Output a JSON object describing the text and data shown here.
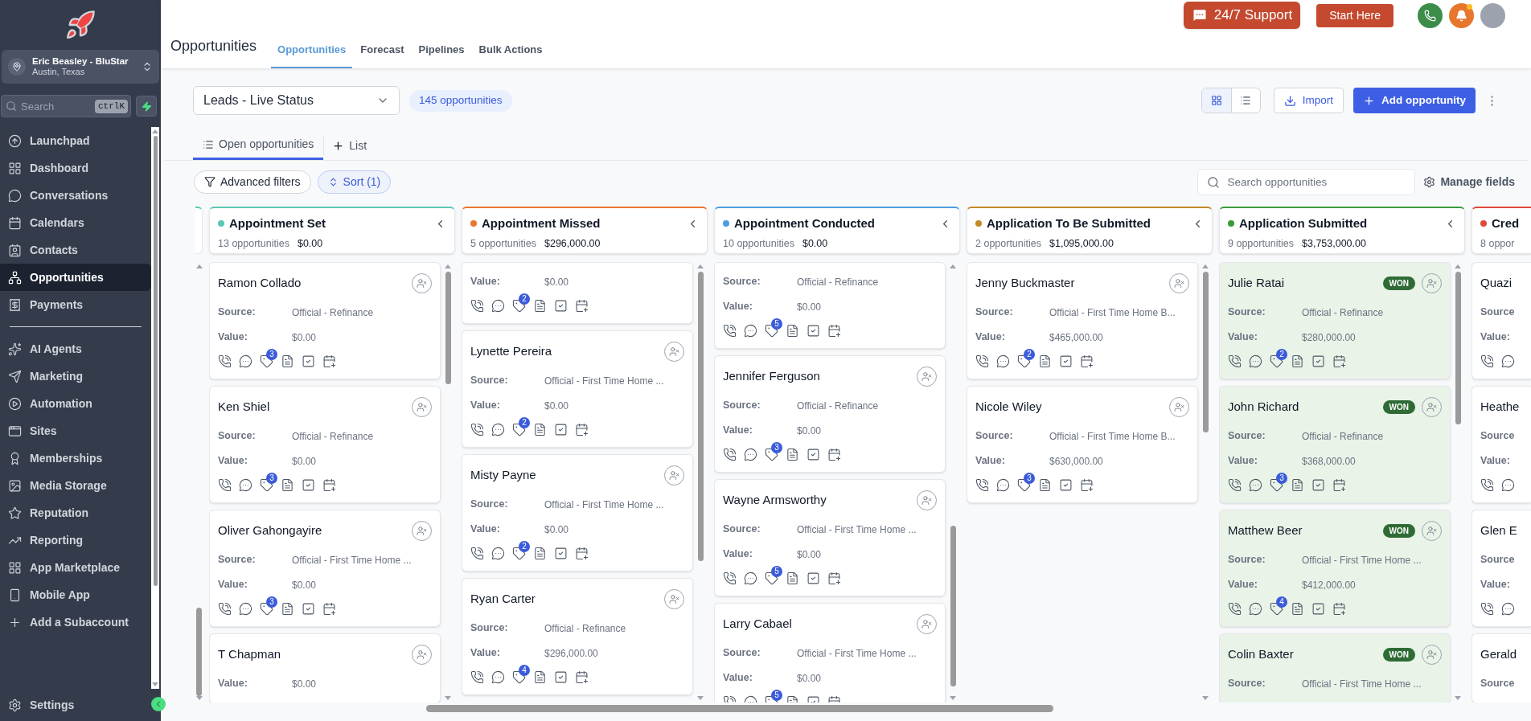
{
  "top_bar": {
    "support_label": "24/7 Support",
    "start_label": "Start Here",
    "has_unread": true
  },
  "sidebar": {
    "account": {
      "name": "Eric Beasley - BluStar",
      "location": "Austin, Texas"
    },
    "search": {
      "placeholder": "Search",
      "shortcut": "ctrlK"
    },
    "items": [
      {
        "label": "Launchpad",
        "selected": false
      },
      {
        "label": "Dashboard",
        "selected": false
      },
      {
        "label": "Conversations",
        "selected": false
      },
      {
        "label": "Calendars",
        "selected": false
      },
      {
        "label": "Contacts",
        "selected": false
      },
      {
        "label": "Opportunities",
        "selected": true
      },
      {
        "label": "Payments",
        "selected": false
      }
    ],
    "items_secondary": [
      {
        "label": "AI Agents",
        "selected": false
      },
      {
        "label": "Marketing",
        "selected": false
      },
      {
        "label": "Automation",
        "selected": false
      },
      {
        "label": "Sites",
        "selected": false
      },
      {
        "label": "Memberships",
        "selected": false
      },
      {
        "label": "Media Storage",
        "selected": false
      },
      {
        "label": "Reputation",
        "selected": false
      },
      {
        "label": "Reporting",
        "selected": false
      },
      {
        "label": "App Marketplace",
        "selected": false
      },
      {
        "label": "Mobile App",
        "selected": false
      },
      {
        "label": "Add a Subaccount",
        "selected": false
      }
    ],
    "settings": "Settings"
  },
  "page": {
    "title": "Opportunities",
    "tabs": [
      {
        "label": "Opportunities",
        "selected": true
      },
      {
        "label": "Forecast",
        "selected": false
      },
      {
        "label": "Pipelines",
        "selected": false
      },
      {
        "label": "Bulk Actions",
        "selected": false
      }
    ]
  },
  "toolbar": {
    "pipeline": "Leads - Live Status",
    "count": "145 opportunities",
    "views": [
      {
        "kind": "grid",
        "selected": true
      },
      {
        "kind": "list",
        "selected": false
      }
    ],
    "import_label": "Import",
    "add_label": "Add opportunity"
  },
  "view_tabs": [
    {
      "label": "Open opportunities",
      "selected": true
    }
  ],
  "add_list_label": "List",
  "filters": {
    "advanced_label": "Advanced filters",
    "sort_label": "Sort (1)",
    "search_placeholder": "Search opportunities",
    "manage_label": "Manage fields"
  },
  "columns": [
    {
      "title": "Appointment Set",
      "color": "#5cc8b4",
      "count": "13 opportunities",
      "total": "$0.00",
      "cards": [
        {
          "kind": "full",
          "name": "Ramon Collado",
          "fields": [
            {
              "label": "Source:",
              "value": "Official - Refinance"
            },
            {
              "label": "Value:",
              "value": "$0.00"
            }
          ],
          "badge": "3"
        },
        {
          "kind": "full",
          "name": "Ken Shiel",
          "fields": [
            {
              "label": "Source:",
              "value": "Official - Refinance"
            },
            {
              "label": "Value:",
              "value": "$0.00"
            }
          ],
          "badge": "3"
        },
        {
          "kind": "full",
          "name": "Oliver Gahongayire",
          "fields": [
            {
              "label": "Source:",
              "value": "Official - First Time Home ..."
            },
            {
              "label": "Value:",
              "value": "$0.00"
            }
          ],
          "badge": "3"
        },
        {
          "kind": "bare",
          "name": "T Chapman",
          "fields": [
            {
              "label": "Value:",
              "value": "$0.00"
            }
          ]
        }
      ]
    },
    {
      "title": "Appointment Missed",
      "color": "#e8772e",
      "count": "5 opportunities",
      "total": "$296,000.00",
      "cards": [
        {
          "kind": "full",
          "fields": [
            {
              "label": "Value:",
              "value": "$0.00"
            }
          ],
          "badge": "2"
        },
        {
          "kind": "full",
          "name": "Lynette Pereira",
          "fields": [
            {
              "label": "Source:",
              "value": "Official - First Time Home ..."
            },
            {
              "label": "Value:",
              "value": "$0.00"
            }
          ],
          "badge": "2"
        },
        {
          "kind": "full",
          "name": "Misty Payne",
          "fields": [
            {
              "label": "Source:",
              "value": "Official - First Time Home ..."
            },
            {
              "label": "Value:",
              "value": "$0.00"
            }
          ],
          "badge": "2"
        },
        {
          "kind": "full",
          "name": "Ryan Carter",
          "fields": [
            {
              "label": "Source:",
              "value": "Official - Refinance"
            },
            {
              "label": "Value:",
              "value": "$296,000.00"
            }
          ],
          "badge": "4"
        }
      ]
    },
    {
      "title": "Appointment Conducted",
      "color": "#4b9de0",
      "count": "10 opportunities",
      "total": "$0.00",
      "cards": [
        {
          "kind": "full",
          "fields": [
            {
              "label": "Source:",
              "value": "Official - Refinance"
            },
            {
              "label": "Value:",
              "value": "$0.00"
            }
          ],
          "badge": "5"
        },
        {
          "kind": "full",
          "name": "Jennifer Ferguson",
          "fields": [
            {
              "label": "Source:",
              "value": "Official - Refinance"
            },
            {
              "label": "Value:",
              "value": "$0.00"
            }
          ],
          "badge": "3"
        },
        {
          "kind": "full",
          "name": "Wayne Armsworthy",
          "fields": [
            {
              "label": "Source:",
              "value": "Official - First Time Home ..."
            },
            {
              "label": "Value:",
              "value": "$0.00"
            }
          ],
          "badge": "5"
        },
        {
          "kind": "full",
          "name": "Larry Cabael",
          "fields": [
            {
              "label": "Source:",
              "value": "Official - First Time Home ..."
            },
            {
              "label": "Value:",
              "value": "$0.00"
            }
          ],
          "badge": "5"
        }
      ]
    },
    {
      "title": "Application To Be Submitted",
      "color": "#c48a2a",
      "count": "2 opportunities",
      "total": "$1,095,000.00",
      "cards": [
        {
          "kind": "full",
          "name": "Jenny Buckmaster",
          "fields": [
            {
              "label": "Source:",
              "value": "Official - First Time Home B..."
            },
            {
              "label": "Value:",
              "value": "$465,000.00"
            }
          ],
          "badge": "2"
        },
        {
          "kind": "full",
          "name": "Nicole Wiley",
          "fields": [
            {
              "label": "Source:",
              "value": "Official - First Time Home B..."
            },
            {
              "label": "Value:",
              "value": "$630,000.00"
            }
          ],
          "badge": "3"
        }
      ]
    },
    {
      "title": "Application Submitted",
      "color": "#3a9a3a",
      "count": "9 opportunities",
      "total": "$3,753,000.00",
      "cards": [
        {
          "kind": "full",
          "name": "Julie Ratai",
          "won": true,
          "status": "WON",
          "fields": [
            {
              "label": "Source:",
              "value": "Official - Refinance"
            },
            {
              "label": "Value:",
              "value": "$280,000.00"
            }
          ],
          "badge": "2"
        },
        {
          "kind": "full",
          "name": "John Richard",
          "won": true,
          "status": "WON",
          "fields": [
            {
              "label": "Source:",
              "value": "Official - Refinance"
            },
            {
              "label": "Value:",
              "value": "$368,000.00"
            }
          ],
          "badge": "3"
        },
        {
          "kind": "full",
          "name": "Matthew Beer",
          "won": true,
          "status": "WON",
          "fields": [
            {
              "label": "Source:",
              "value": "Official - First Time Home ..."
            },
            {
              "label": "Value:",
              "value": "$412,000.00"
            }
          ],
          "badge": "4"
        },
        {
          "kind": "bare",
          "name": "Colin Baxter",
          "won": true,
          "status": "WON",
          "fields": [
            {
              "label": "Source:",
              "value": "Official - First Time Home ..."
            }
          ]
        }
      ]
    },
    {
      "title": "Cred",
      "color": "#e04a3a",
      "count": "8 oppor",
      "cards": [
        {
          "kind": "cut",
          "name": "Quazi",
          "fields": [
            {
              "label": "Source"
            },
            {
              "label": "Value:"
            }
          ]
        },
        {
          "kind": "cut",
          "name": "Heathe",
          "fields": [
            {
              "label": "Source"
            },
            {
              "label": "Value:"
            }
          ]
        },
        {
          "kind": "cut",
          "name": "Glen E",
          "fields": [
            {
              "label": "Source"
            },
            {
              "label": "Value:"
            }
          ]
        },
        {
          "kind": "bare",
          "name": "Gerald",
          "fields": [
            {
              "label": "Source"
            }
          ]
        }
      ]
    }
  ]
}
